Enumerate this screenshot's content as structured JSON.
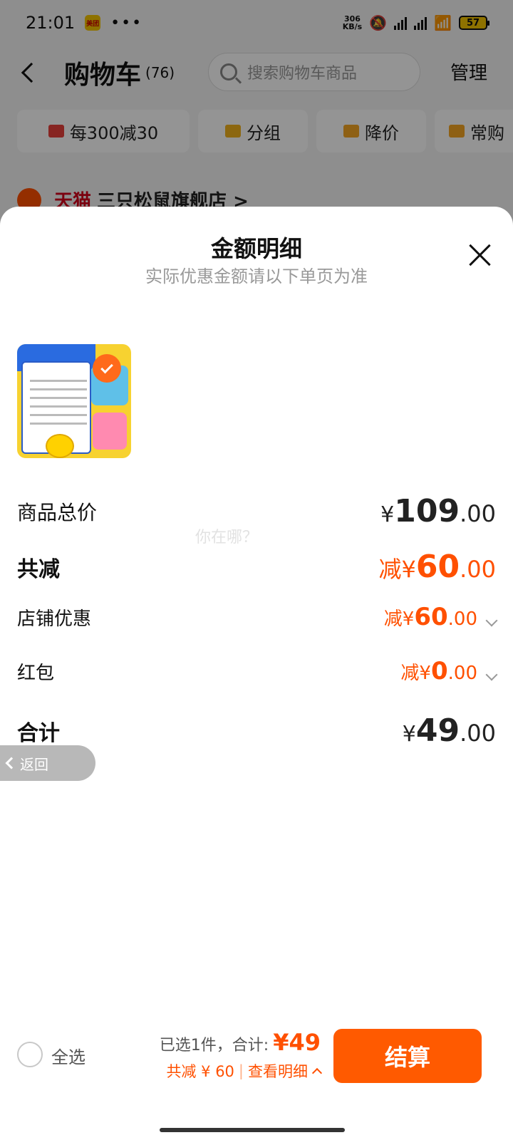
{
  "status_bar": {
    "time": "21:01",
    "app_badge": "美团",
    "dots": "•••",
    "net_speed_top": "306",
    "net_speed_bottom": "KB/s",
    "battery": "57"
  },
  "header": {
    "title": "购物车",
    "count": "(76)",
    "search_placeholder": "搜索购物车商品",
    "manage_label": "管理"
  },
  "filters": [
    {
      "label": "每300减30",
      "icon": "shop-icon",
      "color": "#e8413b"
    },
    {
      "label": "分组",
      "icon": "folder-icon",
      "color": "#f2b21c"
    },
    {
      "label": "降价",
      "icon": "price-down-icon",
      "color": "#f5a623"
    },
    {
      "label": "常购",
      "icon": "cart-icon",
      "color": "#f5a623"
    }
  ],
  "store": {
    "tag": "天猫",
    "name": "三只松鼠旗舰店 >"
  },
  "sheet": {
    "title": "金额明细",
    "subtitle": "实际优惠金额请以下单页为准",
    "watermark": "你在哪？",
    "rows": {
      "total_price": {
        "label": "商品总价",
        "prefix": "¥",
        "main": "109",
        "decimal": ".00"
      },
      "discount": {
        "label": "共减",
        "prefix": "减¥",
        "main": "60",
        "decimal": ".00"
      },
      "store_coupon": {
        "label": "店铺优惠",
        "prefix": "减¥",
        "main": "60",
        "decimal": ".00"
      },
      "red_packet": {
        "label": "红包",
        "prefix": "减¥",
        "main": "0",
        "decimal": ".00"
      },
      "sum": {
        "label": "合计",
        "prefix": "¥",
        "main": "49",
        "decimal": ".00"
      }
    }
  },
  "back_pill": {
    "label": "返回"
  },
  "bottom_bar": {
    "select_all": "全选",
    "selected_text": "已选1件，合计:",
    "price": "¥49",
    "discount_text": "共减 ¥ 60",
    "separator": "|",
    "view_detail": "查看明细",
    "checkout": "结算"
  },
  "colors": {
    "accent": "#ff5000",
    "checkout_bg": "#ff5a00"
  }
}
